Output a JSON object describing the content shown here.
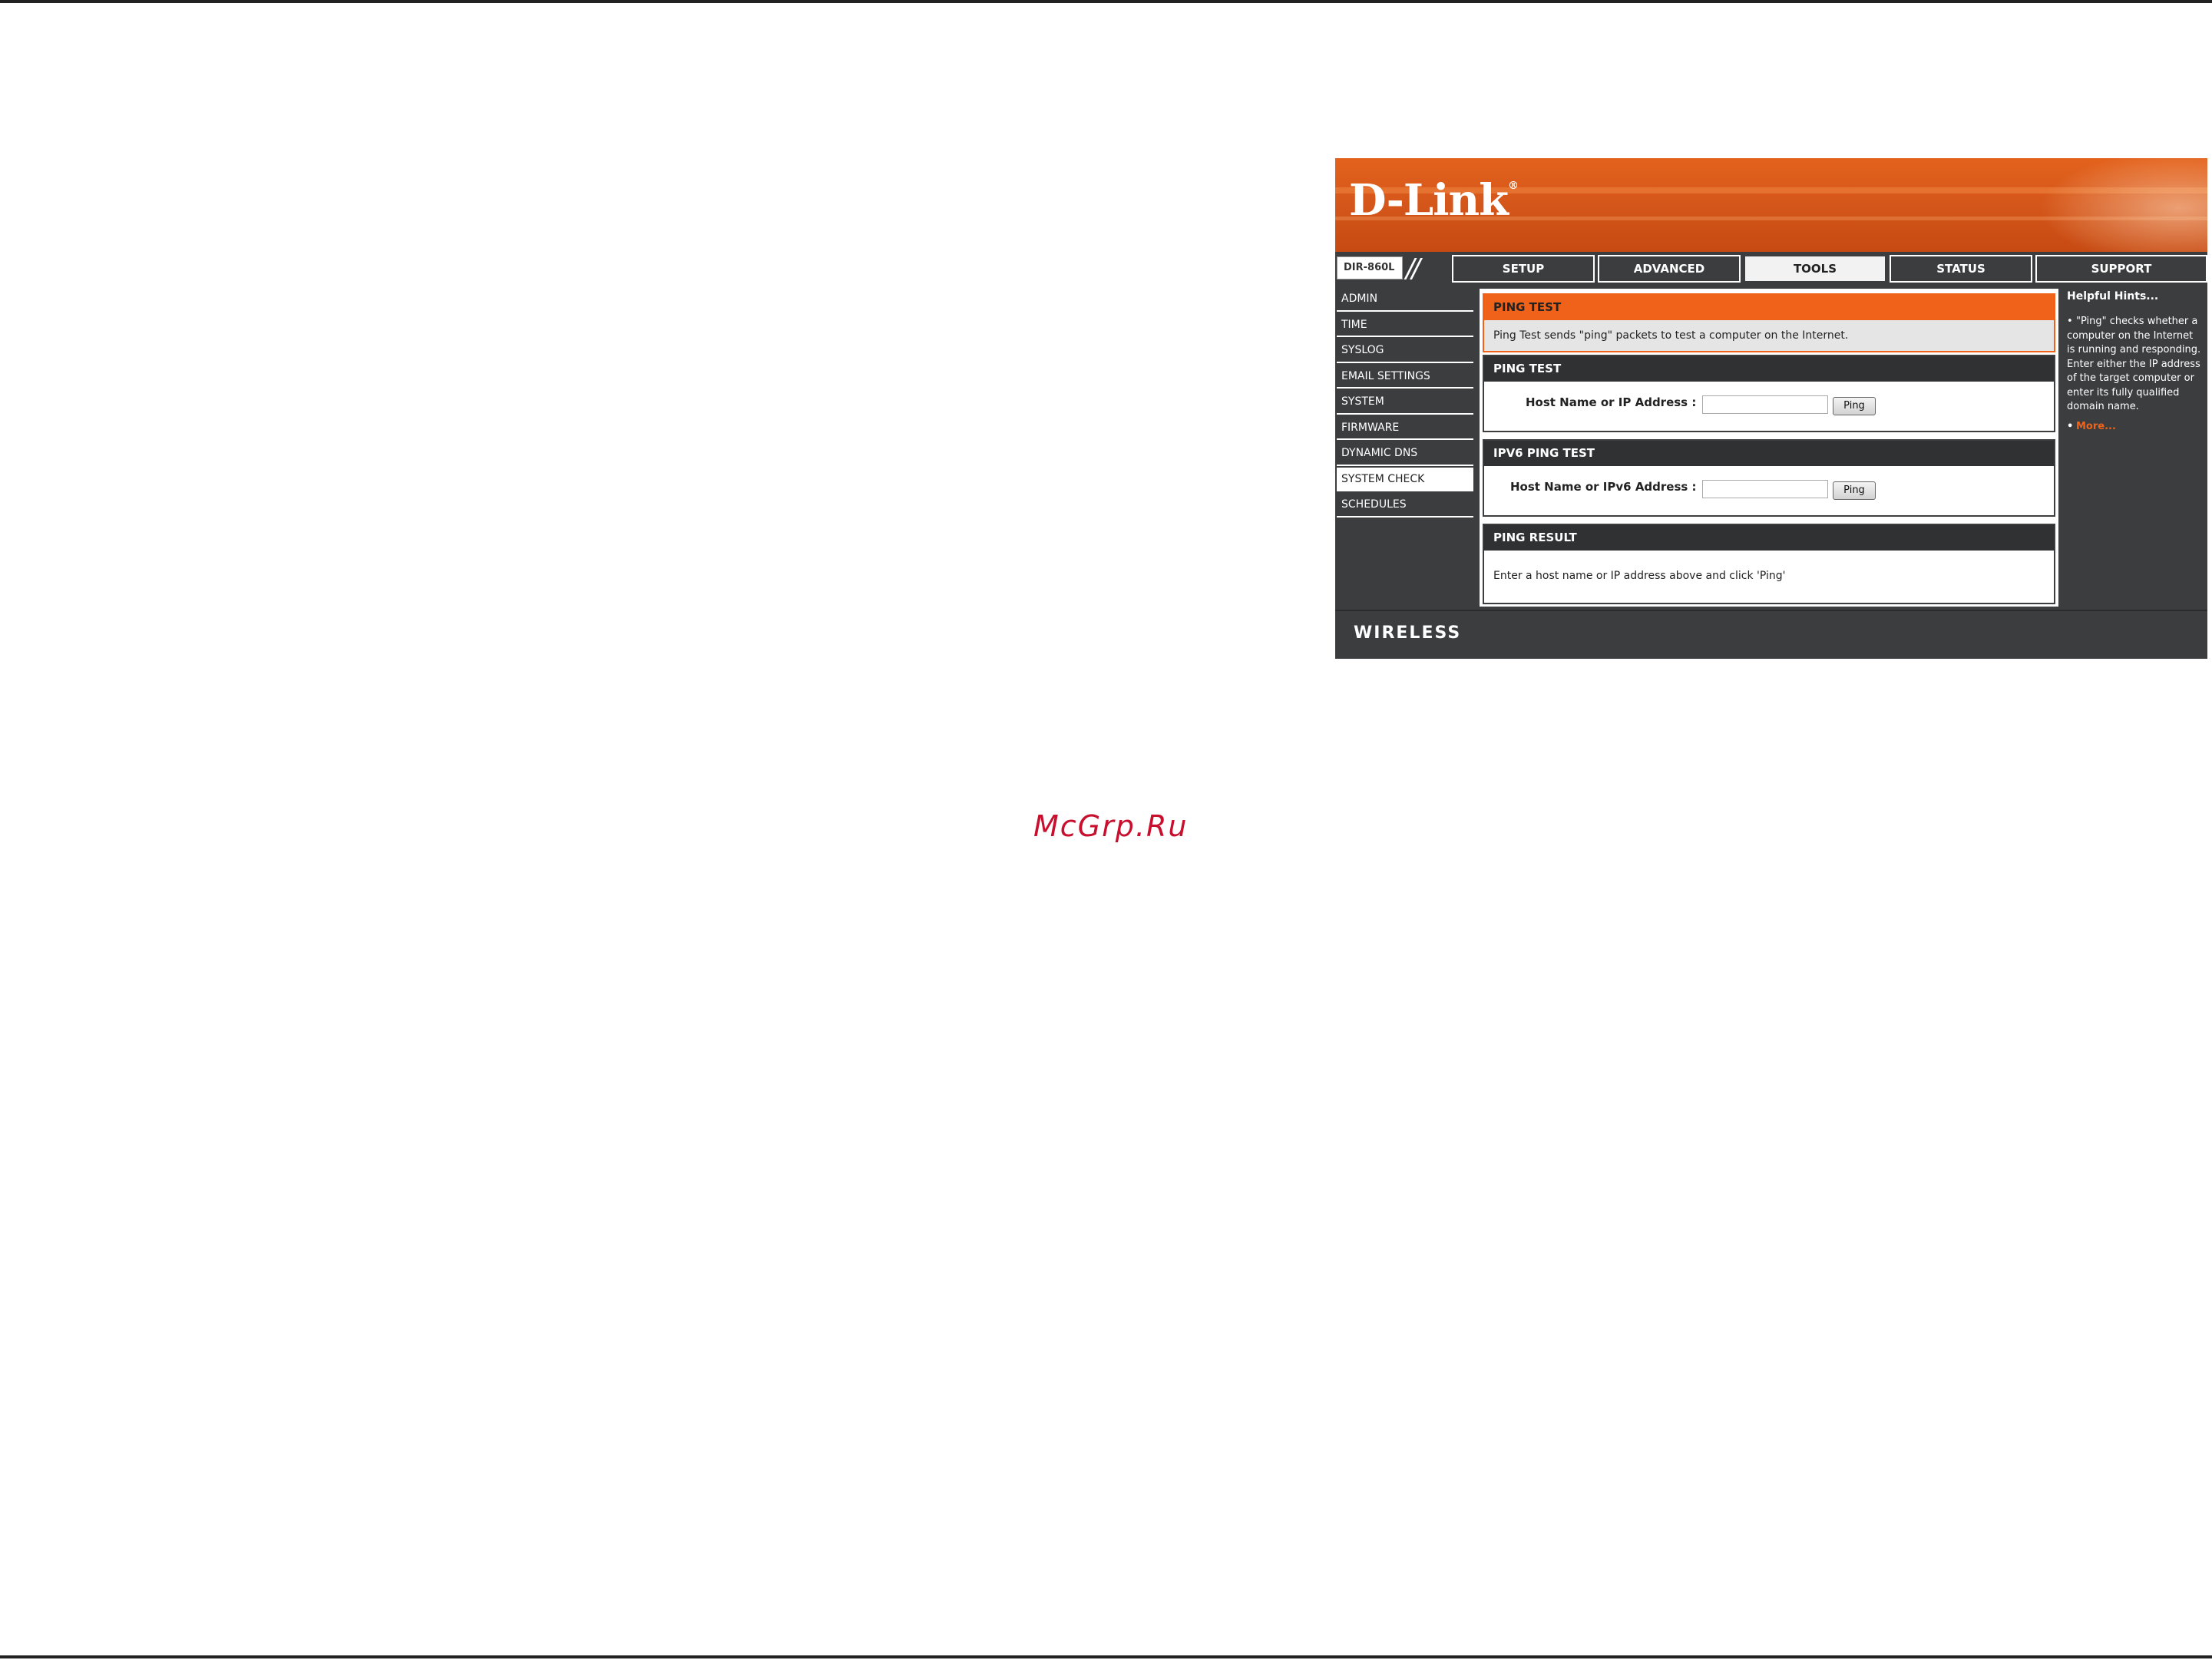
{
  "watermark": "McGrp.Ru",
  "brand": {
    "logo": "D-Link",
    "registered": "®"
  },
  "model": "DIR-860L",
  "nav": {
    "tabs": [
      {
        "label": "SETUP"
      },
      {
        "label": "ADVANCED"
      },
      {
        "label": "TOOLS",
        "active": true
      },
      {
        "label": "STATUS"
      },
      {
        "label": "SUPPORT"
      }
    ]
  },
  "sidebar": {
    "items": [
      {
        "label": "ADMIN"
      },
      {
        "label": "TIME"
      },
      {
        "label": "SYSLOG"
      },
      {
        "label": "EMAIL SETTINGS"
      },
      {
        "label": "SYSTEM"
      },
      {
        "label": "FIRMWARE"
      },
      {
        "label": "DYNAMIC DNS"
      },
      {
        "label": "SYSTEM CHECK",
        "active": true
      },
      {
        "label": "SCHEDULES"
      }
    ]
  },
  "main": {
    "intro": {
      "title": "PING TEST",
      "text": "Ping Test sends \"ping\" packets to test a computer on the Internet."
    },
    "ping_test": {
      "title": "PING TEST",
      "label": "Host Name or IP Address :",
      "value": "",
      "button": "Ping"
    },
    "ipv6_ping_test": {
      "title": "IPV6 PING TEST",
      "label": "Host Name or IPv6 Address :",
      "value": "",
      "button": "Ping"
    },
    "ping_result": {
      "title": "PING RESULT",
      "text": "Enter a host name or IP address above and click 'Ping'"
    }
  },
  "hints": {
    "title": "Helpful Hints...",
    "body": "\"Ping\" checks whether a computer on the Internet is running and responding. Enter either the IP address of the target computer or enter its fully qualified domain name.",
    "more": "More..."
  },
  "footer": {
    "brand": "WIRELESS"
  },
  "colors": {
    "accent": "#f06219",
    "panel": "#3b3d3e",
    "header": "#2f3132"
  }
}
